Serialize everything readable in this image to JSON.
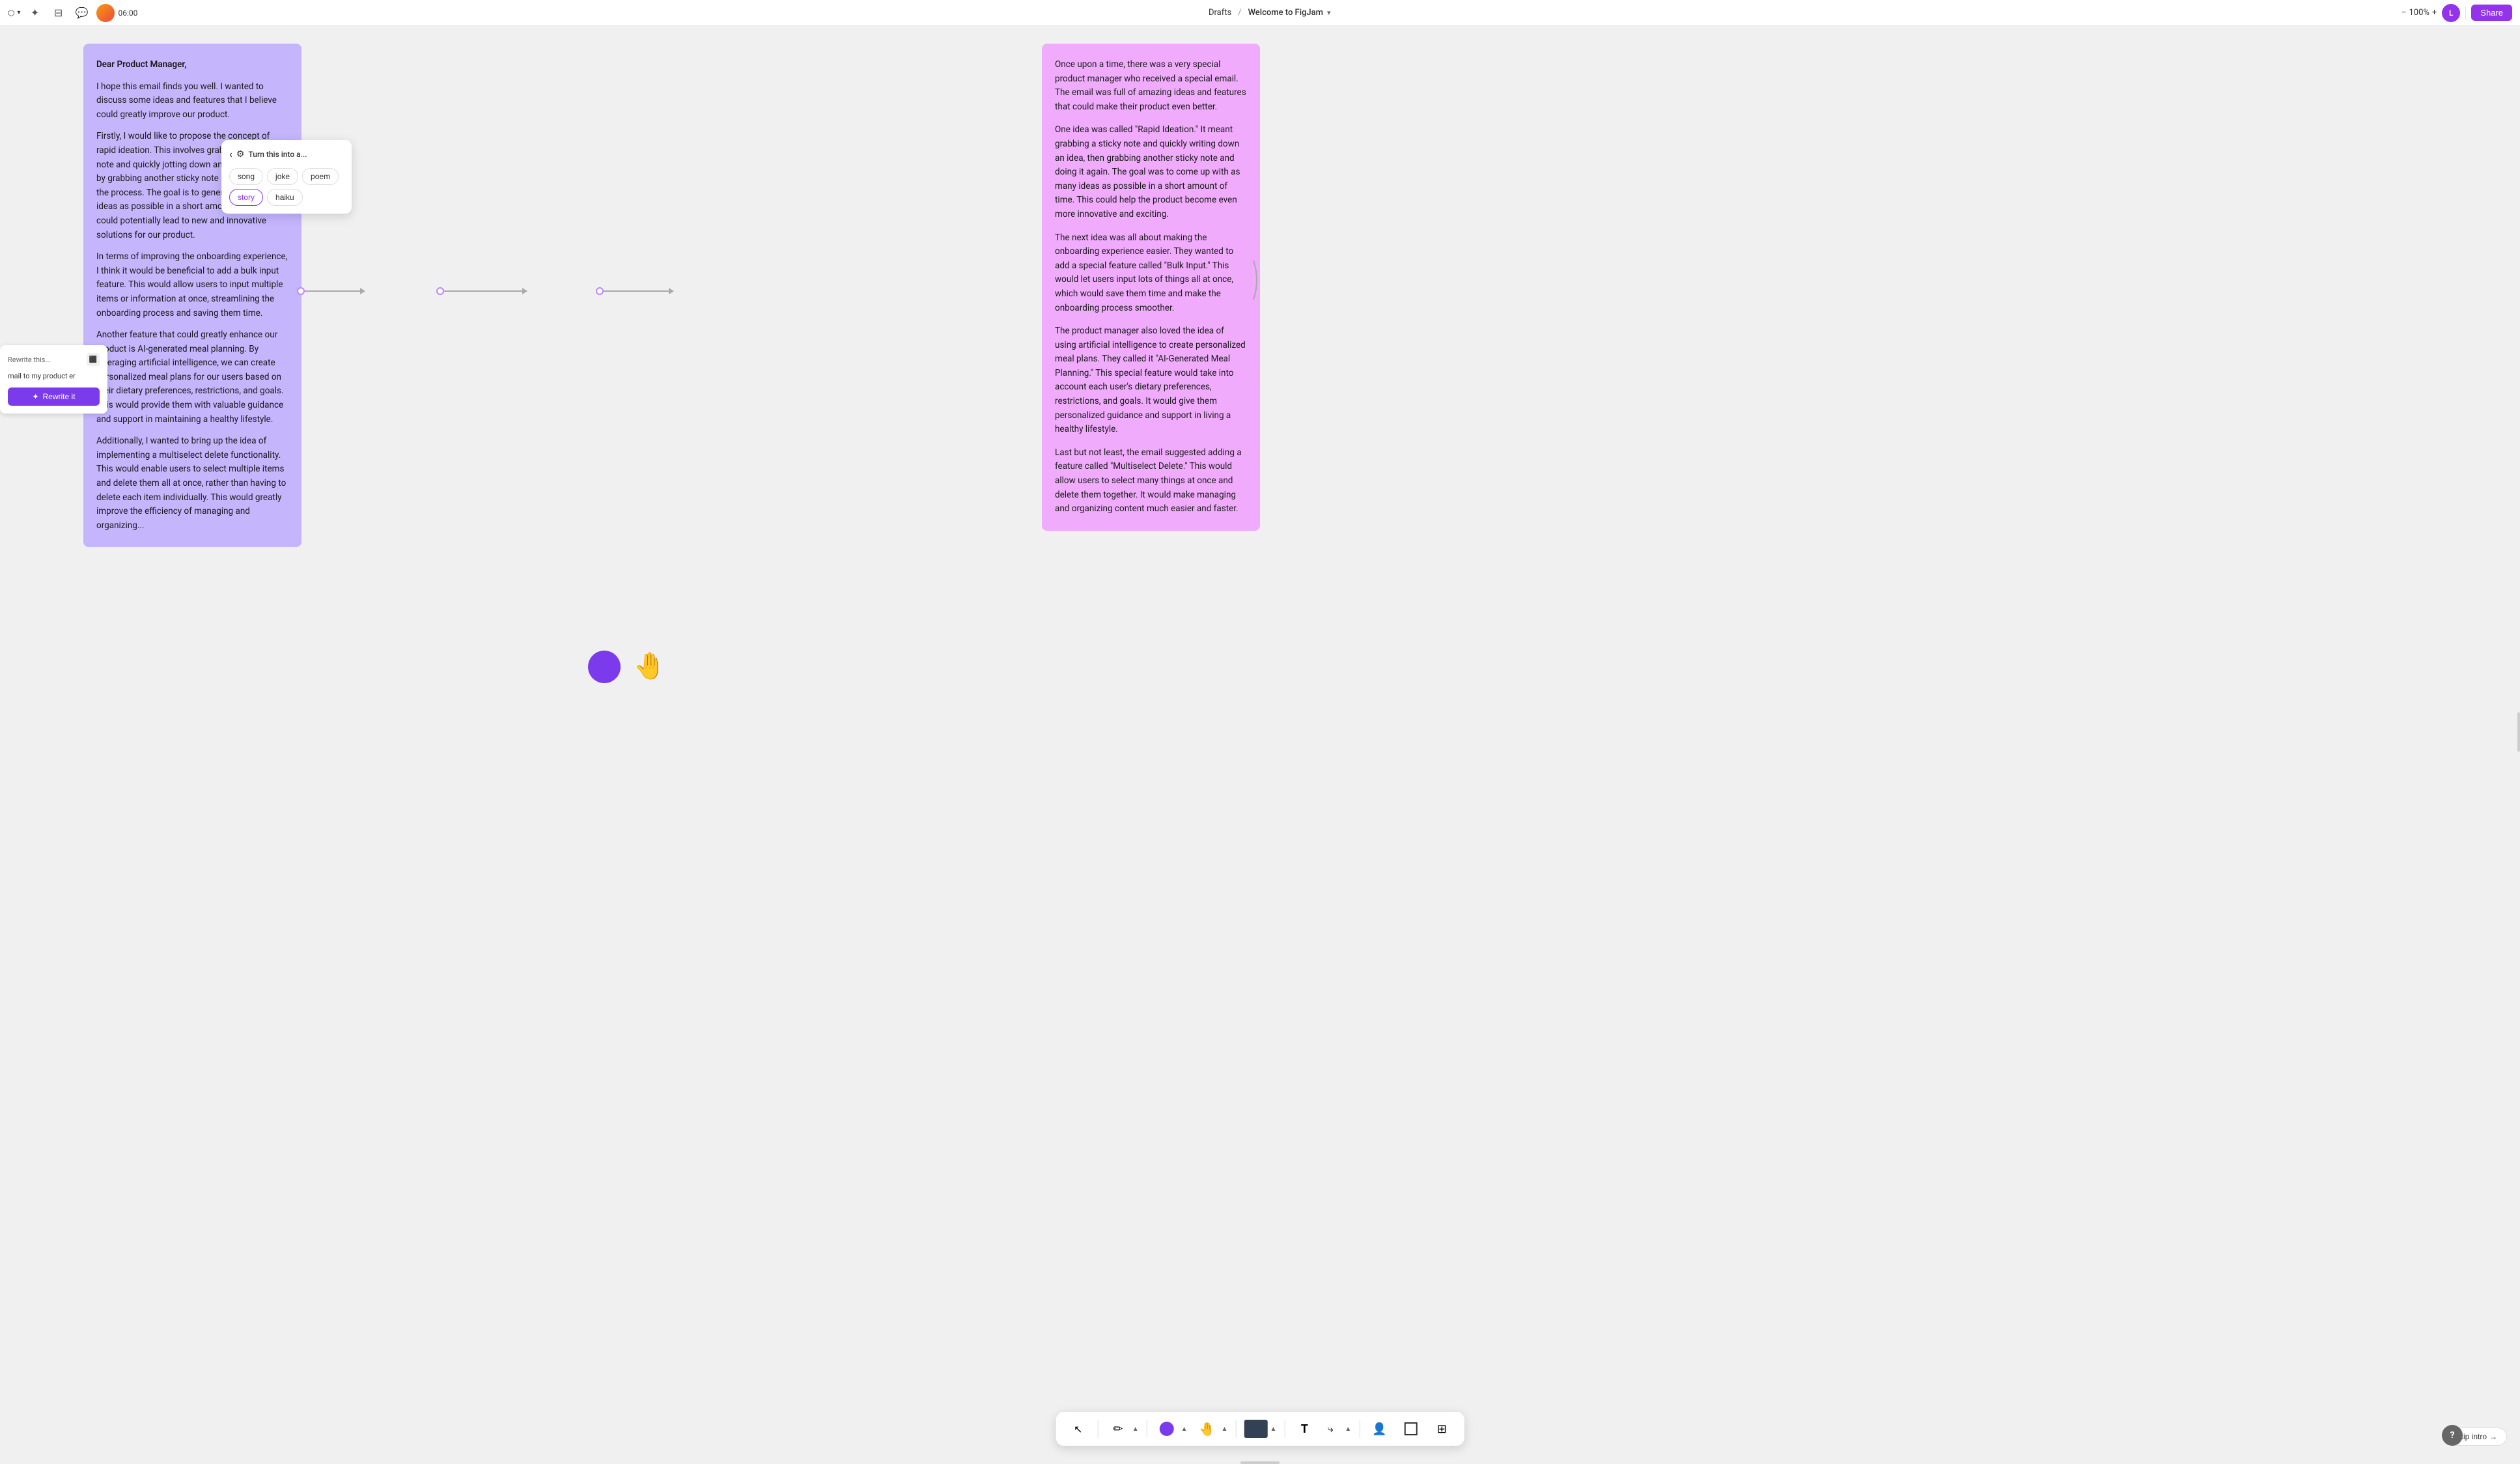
{
  "topbar": {
    "menu_label": "☰",
    "avatar_letter": "L",
    "share_label": "Share",
    "zoom_label": "100%",
    "time": "06:00",
    "breadcrumb_drafts": "Drafts",
    "breadcrumb_sep": "/",
    "breadcrumb_current": "Welcome to FigJam",
    "zoom_minus": "−",
    "zoom_plus": "+"
  },
  "rewrite_panel": {
    "title": "Rewrite this...",
    "icon": "🖼",
    "text": "mail to my product er",
    "button_label": "Rewrite it",
    "button_icon": "✦"
  },
  "left_note": {
    "greeting": "Dear Product Manager,",
    "para1": "I hope this email finds you well. I wanted to discuss some ideas and features that I believe could greatly improve our product.",
    "para2": "Firstly, I would like to propose the concept of rapid ideation. This involves grabbing a sticky note and quickly jotting down an idea, followed by grabbing another sticky note and repeating the process. The goal is to generate as many ideas as possible in a short amount of time. This could potentially lead to new and innovative solutions for our product.",
    "para3": "In terms of improving the onboarding experience, I think it would be beneficial to add a bulk input feature. This would allow users to input multiple items or information at once, streamlining the onboarding process and saving them time.",
    "para4": "Another feature that could greatly enhance our product is AI-generated meal planning. By leveraging artificial intelligence, we can create personalized meal plans for our users based on their dietary preferences, restrictions, and goals. This would provide them with valuable guidance and support in maintaining a healthy lifestyle.",
    "para5": "Additionally, I wanted to bring up the idea of implementing a multiselect delete functionality. This would enable users to select multiple items and delete them all at once, rather than having to delete each item individually. This would greatly improve the efficiency of managing and organizing..."
  },
  "turn_into": {
    "back_icon": "‹",
    "ai_icon": "⚙",
    "title": "Turn this into a...",
    "options": [
      "song",
      "joke",
      "poem",
      "story",
      "haiku"
    ],
    "selected": "story"
  },
  "right_note": {
    "para1": "Once upon a time, there was a very special product manager who received a special email. The email was full of amazing ideas and features that could make their product even better.",
    "para2": "One idea was called \"Rapid Ideation.\" It meant grabbing a sticky note and quickly writing down an idea, then grabbing another sticky note and doing it again. The goal was to come up with as many ideas as possible in a short amount of time. This could help the product become even more innovative and exciting.",
    "para3": "The next idea was all about making the onboarding experience easier. They wanted to add a special feature called \"Bulk Input.\" This would let users input lots of things all at once, which would save them time and make the onboarding process smoother.",
    "para4": "The product manager also loved the idea of using artificial intelligence to create personalized meal plans. They called it \"AI-Generated Meal Planning.\" This special feature would take into account each user's dietary preferences, restrictions, and goals. It would give them personalized guidance and support in living a healthy lifestyle.",
    "para5": "Last but not least, the email suggested adding a feature called \"Multiselect Delete.\" This would allow users to select many things at once and delete them together. It would make managing and organizing content much easier and faster."
  },
  "toolbar": {
    "cursor_icon": "↖",
    "pen_icon": "✏",
    "expand1": "▲",
    "circle_color": "#7c3aed",
    "hand_icon": "✋",
    "expand2": "▲",
    "screen_preview": "▤",
    "expand3": "▲",
    "text_icon": "T",
    "connector_icon": "⤷",
    "expand4": "▲",
    "person_icon": "👤",
    "frame_icon": "⬜",
    "grid_icon": "⊞"
  },
  "skip_intro": {
    "label": "Skip intro",
    "arrow": "→"
  },
  "help": {
    "label": "?"
  },
  "colors": {
    "left_note_bg": "#c4b5fd",
    "right_note_bg": "#f0abfc",
    "rewrite_btn": "#7c3aed",
    "share_btn": "#9333ea",
    "selected_chip_border": "#9333ea",
    "selected_chip_color": "#9333ea"
  }
}
